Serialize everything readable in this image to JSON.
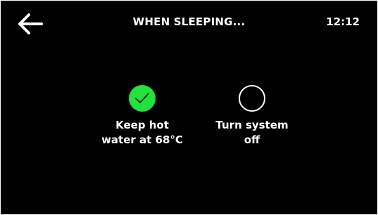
{
  "header": {
    "back_icon": "arrow-left-icon",
    "title": "WHEN SLEEPING...",
    "time": "12:12"
  },
  "options": [
    {
      "label": "Keep hot\nwater at 68°C",
      "selected": true,
      "icon": "checkmark-icon"
    },
    {
      "label": "Turn system\noff",
      "selected": false
    }
  ],
  "colors": {
    "background": "#000000",
    "text": "#ffffff",
    "selected_accent": "#23e23b"
  }
}
